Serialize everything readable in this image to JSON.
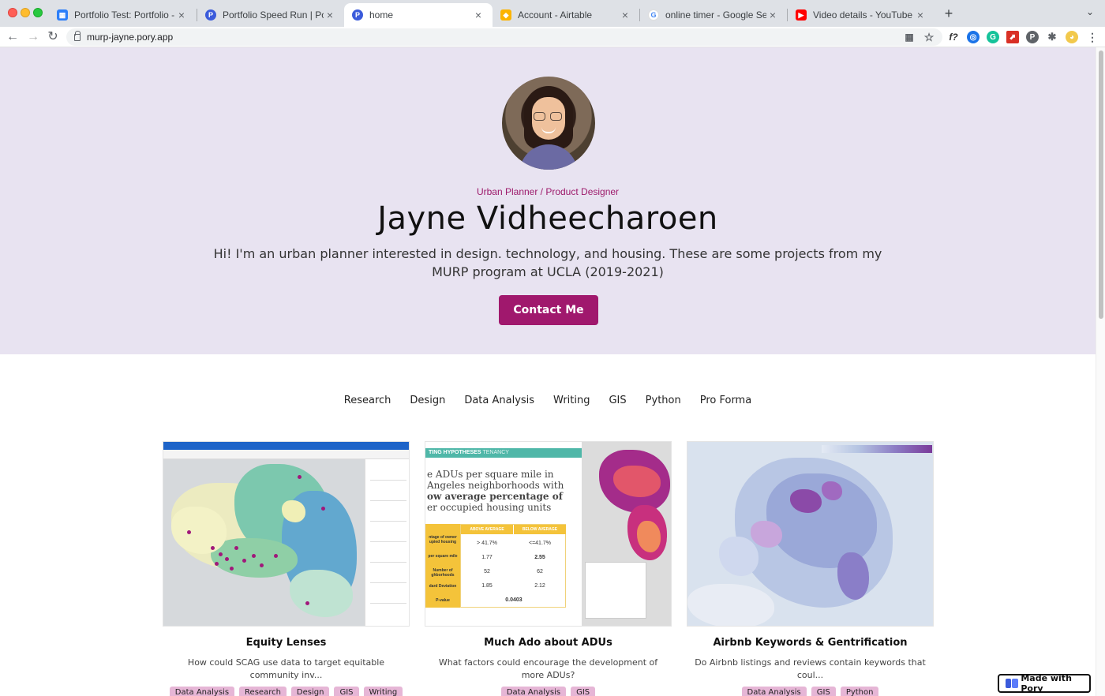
{
  "browser": {
    "tabs": [
      {
        "title": "Portfolio Test: Portfolio - Airtab",
        "favicon": "airtable-grid-icon",
        "color": "#2d7ff9"
      },
      {
        "title": "Portfolio Speed Run | Pory",
        "favicon": "pory-icon",
        "color": "#3b5bdb"
      },
      {
        "title": "home",
        "favicon": "pory-icon",
        "color": "#3b5bdb"
      },
      {
        "title": "Account - Airtable",
        "favicon": "airtable-icon",
        "color": "#fcb400"
      },
      {
        "title": "online timer - Google Search",
        "favicon": "google-icon",
        "color": "#4285f4"
      },
      {
        "title": "Video details - YouTube Studio",
        "favicon": "youtube-icon",
        "color": "#ff0000"
      }
    ],
    "active_tab": 2,
    "url": "murp-jayne.pory.app"
  },
  "hero": {
    "subtitle": "Urban Planner / Product Designer",
    "name": "Jayne Vidheecharoen",
    "bio": "Hi! I'm an urban planner interested in design. technology, and housing. These are some projects from my MURP program at UCLA (2019-2021)",
    "contact_label": "Contact Me",
    "background": "#e8e3f1",
    "accent": "#a0186d"
  },
  "filters": [
    "Research",
    "Design",
    "Data Analysis",
    "Writing",
    "GIS",
    "Python",
    "Pro Forma"
  ],
  "projects": [
    {
      "title": "Equity Lenses",
      "description": "How could SCAG use data to target equitable community inv...",
      "tags": [
        "Data Analysis",
        "Research",
        "Design",
        "GIS",
        "Writing"
      ]
    },
    {
      "title": "Much Ado about ADUs",
      "description": "What factors could encourage the development of more ADUs?",
      "tags": [
        "Data Analysis",
        "GIS"
      ]
    },
    {
      "title": "Airbnb Keywords & Gentrification",
      "description": "Do Airbnb listings and reviews contain keywords that coul...",
      "tags": [
        "Data Analysis",
        "GIS",
        "Python"
      ]
    }
  ],
  "thumb2": {
    "header": "TING HYPOTHESES",
    "header_sub": "TENANCY",
    "lines": [
      "e ADUs per square mile in",
      "Angeles neighborhoods with",
      "ow average percentage of",
      "er occupied housing units"
    ],
    "col_above": "ABOVE AVERAGE",
    "col_below": "BELOW AVERAGE",
    "rows": [
      {
        "label": "ntage of owner upied housing",
        "above": "> 41.7%",
        "below": "<=41.7%"
      },
      {
        "label": "per square mile",
        "above": "1.77",
        "below": "2.55"
      },
      {
        "label": "Number of ghborhoods",
        "above": "52",
        "below": "62"
      },
      {
        "label": "dard Deviation",
        "above": "1.85",
        "below": "2.12"
      },
      {
        "label": "P-value",
        "above": "0.0403",
        "below": ""
      }
    ]
  },
  "badge": {
    "label": "Made with Pory"
  }
}
